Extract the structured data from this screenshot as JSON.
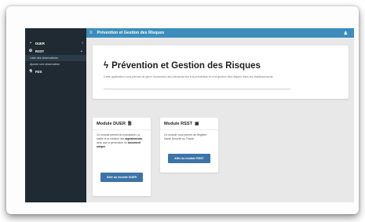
{
  "header": {
    "title": "Prévention et Gestion des Risques",
    "menu_icon": "hamburger-icon",
    "user_icon": "user-icon"
  },
  "sidebar": {
    "items": [
      {
        "label": "DUER",
        "icon": "document-icon"
      },
      {
        "label": "RSST",
        "icon": "gear-icon"
      },
      {
        "label": "Liste des observations"
      },
      {
        "label": "Ajouter une observation"
      },
      {
        "label": "FDS",
        "icon": "flask-icon"
      }
    ]
  },
  "hero": {
    "title": "Prévention et Gestion des Risques",
    "title_icon": "bolt-icon",
    "description": "Cette application vous permet de gérer l'ensemble des éléments liés à la prévention et à la gestion des risques dans les établissements."
  },
  "cards": {
    "duer": {
      "title": "Module DUER",
      "icon": "file-icon",
      "text_before": "Ce module permet la consultation, la saisie et la création des",
      "text_bold1": "signalements",
      "text_mid": ", ainsi que la génération du",
      "text_bold2": "document unique",
      "text_after": ".",
      "button": "Aller au module DUER"
    },
    "rsst": {
      "title": "Module RSST",
      "icon": "book-icon",
      "text": "Ce module vous permet de Registre Santé Sécurité au Travail",
      "button": "Aller au module RSST"
    }
  },
  "colors": {
    "topbar": "#3c8dbc",
    "sidebar": "#1f2a33",
    "button": "#3c74a8",
    "background": "#e8e8e8"
  }
}
